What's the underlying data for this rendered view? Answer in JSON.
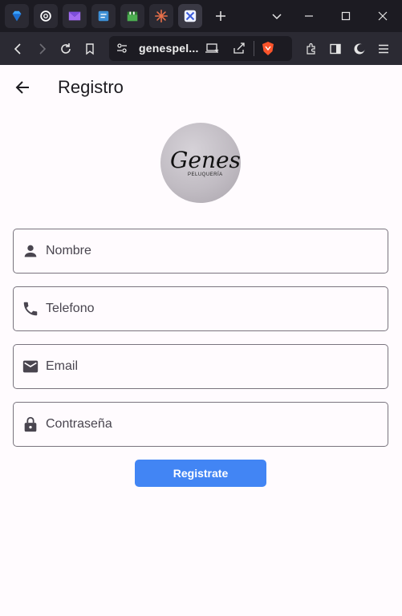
{
  "browser": {
    "tabs": [
      "gem-icon",
      "openai-icon",
      "m-logo-icon",
      "notes-icon",
      "clapper-icon",
      "sunburst-icon",
      "tools-icon"
    ],
    "url": "genespel...",
    "accent_shield": "#fb542b"
  },
  "app": {
    "title": "Registro"
  },
  "logo": {
    "name": "Genes",
    "sub": "PELUQUERÍA"
  },
  "form": {
    "fields": [
      {
        "placeholder": "Nombre",
        "icon": "person-icon"
      },
      {
        "placeholder": "Telefono",
        "icon": "phone-icon"
      },
      {
        "placeholder": "Email",
        "icon": "email-icon"
      },
      {
        "placeholder": "Contraseña",
        "icon": "lock-icon"
      }
    ],
    "submit_label": "Registrate"
  },
  "colors": {
    "primary": "#4285f4",
    "page_bg": "#fffbfe",
    "outline": "#79747e"
  }
}
